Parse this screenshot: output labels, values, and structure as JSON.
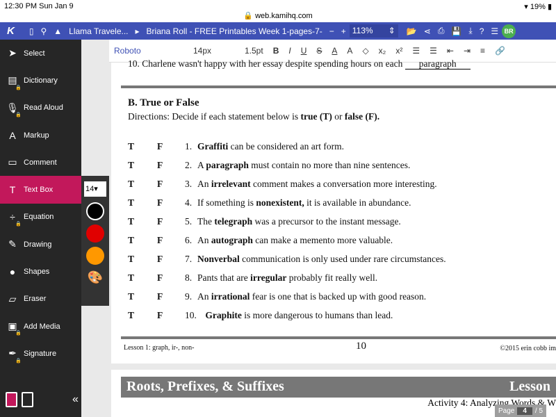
{
  "status": {
    "time": "12:30 PM   Sun Jan 9",
    "battery": "19%",
    "url": "web.kamihq.com"
  },
  "topbar": {
    "logo": "K",
    "breadcrumb1": "Llama Travele...",
    "breadcrumb2": "Briana Roll - FREE Printables Week 1-pages-7-",
    "zoom": "113%",
    "avatar": "BR"
  },
  "format": {
    "font": "Roboto",
    "size": "14px",
    "line": "1.5pt"
  },
  "sidebar": {
    "items": [
      {
        "label": "Select",
        "icon": "cursor-icon"
      },
      {
        "label": "Dictionary",
        "icon": "book-icon"
      },
      {
        "label": "Read Aloud",
        "icon": "microphone-icon"
      },
      {
        "label": "Markup",
        "icon": "highlight-icon"
      },
      {
        "label": "Comment",
        "icon": "comment-icon"
      },
      {
        "label": "Text Box",
        "icon": "text-icon"
      },
      {
        "label": "Equation",
        "icon": "divide-icon"
      },
      {
        "label": "Drawing",
        "icon": "brush-icon"
      },
      {
        "label": "Shapes",
        "icon": "shapes-icon"
      },
      {
        "label": "Eraser",
        "icon": "eraser-icon"
      },
      {
        "label": "Add Media",
        "icon": "image-icon"
      },
      {
        "label": "Signature",
        "icon": "pen-icon"
      }
    ]
  },
  "palette": {
    "size": "14",
    "colors": [
      "#000000",
      "#e00000",
      "#ff9800"
    ]
  },
  "doc": {
    "top_line": "10. Charlene wasn't happy with her essay despite spending hours on each",
    "top_answer": "paragraph",
    "section": "B. True or False",
    "directions_a": "Directions: Decide if each statement below is ",
    "directions_t": "true (T)",
    "directions_or": " or ",
    "directions_f": "false (F).",
    "rows": [
      {
        "n": "1.",
        "pre": "",
        "b": "Graffiti",
        "post": " can be considered an art form."
      },
      {
        "n": "2.",
        "pre": "A ",
        "b": "paragraph",
        "post": " must contain no more than nine sentences."
      },
      {
        "n": "3.",
        "pre": "An ",
        "b": "irrelevant",
        "post": " comment makes a conversation more interesting."
      },
      {
        "n": "4.",
        "pre": "If something is ",
        "b": "nonexistent,",
        "post": " it is available in abundance."
      },
      {
        "n": "5.",
        "pre": "The ",
        "b": "telegraph",
        "post": " was a precursor to the instant message."
      },
      {
        "n": "6.",
        "pre": "An ",
        "b": "autograph",
        "post": " can make a memento more valuable."
      },
      {
        "n": "7.",
        "pre": "",
        "b": "Nonverbal",
        "post": " communication is only used under rare circumstances."
      },
      {
        "n": "8.",
        "pre": "Pants that are ",
        "b": "irregular",
        "post": " probably fit really well."
      },
      {
        "n": "9.",
        "pre": "An ",
        "b": "irrational",
        "post": " fear is one that is backed up with good reason."
      },
      {
        "n": "10.",
        "pre": " ",
        "b": "Graphite",
        "post": " is more dangerous to humans than lead."
      }
    ],
    "t": "T",
    "f": "F",
    "footer_left": "Lesson 1: graph, ir-, non-",
    "footer_page": "10",
    "footer_right": "©2015 erin cobb  im",
    "page2_title": "Roots, Prefixes, & Suffixes",
    "page2_right": "Lesson",
    "page2_sub": "Activity 4: Analyzing Words & W"
  },
  "pager": {
    "label": "Page",
    "current": "4",
    "total": "/ 5"
  }
}
